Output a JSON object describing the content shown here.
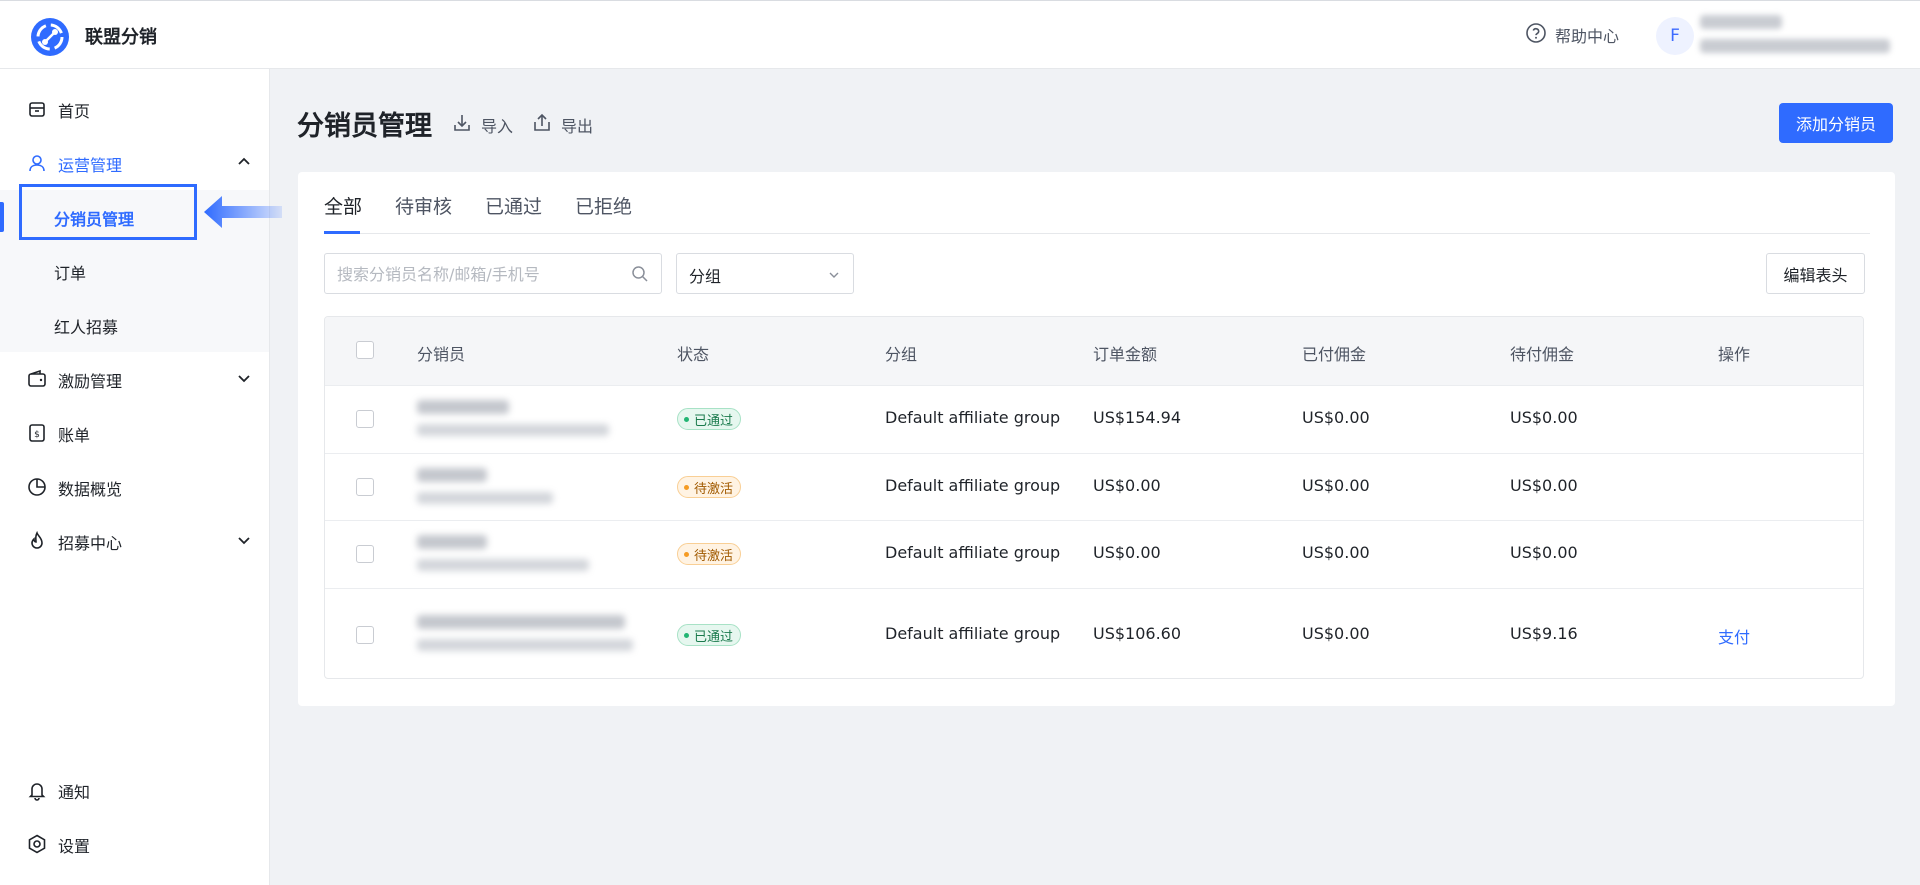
{
  "app": {
    "title": "联盟分销"
  },
  "header": {
    "help_label": "帮助中心",
    "avatar_letter": "F"
  },
  "sidebar": {
    "items": [
      {
        "label": "首页"
      },
      {
        "label": "运营管理"
      },
      {
        "label": "分销员管理"
      },
      {
        "label": "订单"
      },
      {
        "label": "红人招募"
      },
      {
        "label": "激励管理"
      },
      {
        "label": "账单"
      },
      {
        "label": "数据概览"
      },
      {
        "label": "招募中心"
      }
    ],
    "bottom": [
      {
        "label": "通知"
      },
      {
        "label": "设置"
      }
    ]
  },
  "page": {
    "title": "分销员管理",
    "import_label": "导入",
    "export_label": "导出",
    "add_label": "添加分销员"
  },
  "tabs": [
    "全部",
    "待审核",
    "已通过",
    "已拒绝"
  ],
  "filters": {
    "search_placeholder": "搜索分销员名称/邮箱/手机号",
    "group_select": "分组",
    "edit_columns_label": "编辑表头"
  },
  "table": {
    "columns": [
      "分销员",
      "状态",
      "分组",
      "订单金额",
      "已付佣金",
      "待付佣金",
      "操作"
    ],
    "rows": [
      {
        "status": "已通过",
        "group": "Default affiliate group",
        "order_amount": "US$154.94",
        "paid": "US$0.00",
        "pending": "US$0.00",
        "action": ""
      },
      {
        "status": "待激活",
        "group": "Default affiliate group",
        "order_amount": "US$0.00",
        "paid": "US$0.00",
        "pending": "US$0.00",
        "action": ""
      },
      {
        "status": "待激活",
        "group": "Default affiliate group",
        "order_amount": "US$0.00",
        "paid": "US$0.00",
        "pending": "US$0.00",
        "action": ""
      },
      {
        "status": "已通过",
        "group": "Default affiliate group",
        "order_amount": "US$106.60",
        "paid": "US$0.00",
        "pending": "US$9.16",
        "action": "支付"
      }
    ]
  },
  "colors": {
    "accent": "#2f6bff",
    "approved": "#22b573",
    "pending": "#f59b23"
  }
}
